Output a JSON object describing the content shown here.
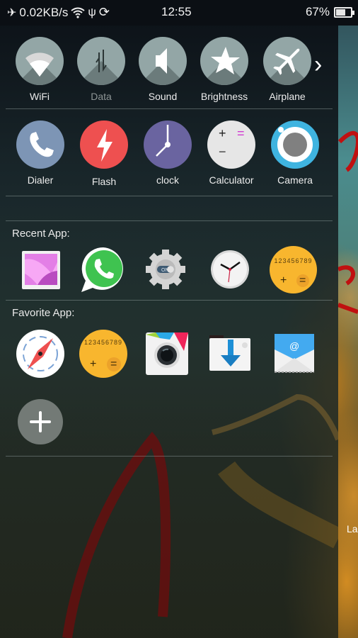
{
  "status_bar": {
    "network_speed": "0.02KB/s",
    "time": "12:55",
    "battery_percent": "67%",
    "battery_level": 0.67,
    "icons": [
      "airplane-mode-icon",
      "wifi-icon",
      "usb-icon",
      "sync-icon",
      "battery-icon"
    ]
  },
  "toggles": [
    {
      "label": "WiFi",
      "icon": "wifi-icon",
      "enabled": true
    },
    {
      "label": "Data",
      "icon": "data-icon",
      "enabled": false
    },
    {
      "label": "Sound",
      "icon": "speaker-icon",
      "enabled": true
    },
    {
      "label": "Brightness",
      "icon": "star-icon",
      "enabled": true
    },
    {
      "label": "Airplane",
      "icon": "airplane-icon",
      "enabled": true
    }
  ],
  "toggles_more": "›",
  "shortcuts": [
    {
      "label": "Dialer",
      "icon": "phone-icon",
      "color": "#7d95b5"
    },
    {
      "label": "Flash",
      "icon": "flash-icon",
      "color": "#ee5050"
    },
    {
      "label": "clock",
      "icon": "clock-icon",
      "color": "#6a64a0"
    },
    {
      "label": "Calculator",
      "icon": "calculator-icon",
      "color": "#e6e6e6"
    },
    {
      "label": "Camera",
      "icon": "camera-icon",
      "color": "#3fb4e0"
    }
  ],
  "recent": {
    "title": "Recent App:",
    "apps": [
      {
        "name": "Gallery",
        "icon": "gallery-icon"
      },
      {
        "name": "WhatsApp",
        "icon": "whatsapp-icon"
      },
      {
        "name": "Settings",
        "icon": "settings-gear-icon"
      },
      {
        "name": "Clock",
        "icon": "analog-clock-icon"
      },
      {
        "name": "Calculator",
        "icon": "calculator-app-icon"
      }
    ]
  },
  "favorite": {
    "title": "Favorite App:",
    "apps": [
      {
        "name": "Browser",
        "icon": "compass-icon"
      },
      {
        "name": "Calculator",
        "icon": "calculator-app-icon"
      },
      {
        "name": "Photo Editor",
        "icon": "photo-camera-icon"
      },
      {
        "name": "Downloads",
        "icon": "download-icon"
      },
      {
        "name": "Email",
        "icon": "email-icon"
      }
    ]
  },
  "calc_digits": "123456789",
  "calc_plus": "+",
  "calc_equals": "=",
  "calc_minus": "−",
  "settings_toggle_text": "ON",
  "email_at": "@",
  "add_button_glyph": "+",
  "edge_text": "La"
}
